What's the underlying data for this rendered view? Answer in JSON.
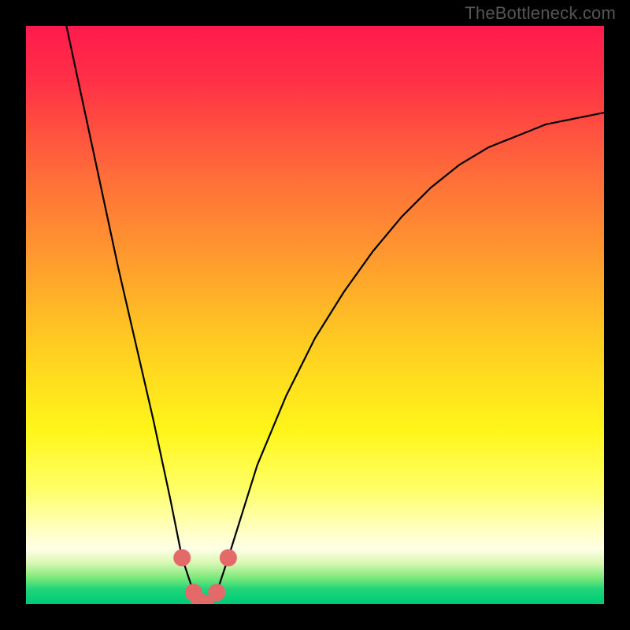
{
  "watermark": "TheBottleneck.com",
  "chart_data": {
    "type": "line",
    "title": "",
    "xlabel": "",
    "ylabel": "",
    "xlim": [
      0,
      100
    ],
    "ylim": [
      0,
      100
    ],
    "grid": false,
    "legend": false,
    "background": {
      "type": "vertical-gradient",
      "stops": [
        {
          "offset": 0.0,
          "color": "#ff1a4d"
        },
        {
          "offset": 0.1,
          "color": "#ff3246"
        },
        {
          "offset": 0.25,
          "color": "#ff6a3a"
        },
        {
          "offset": 0.4,
          "color": "#ff9a2e"
        },
        {
          "offset": 0.55,
          "color": "#ffcc22"
        },
        {
          "offset": 0.7,
          "color": "#fff61a"
        },
        {
          "offset": 0.8,
          "color": "#ffff66"
        },
        {
          "offset": 0.87,
          "color": "#ffffc0"
        },
        {
          "offset": 0.905,
          "color": "#ffffe6"
        },
        {
          "offset": 0.93,
          "color": "#d6f7b0"
        },
        {
          "offset": 0.955,
          "color": "#7ae87a"
        },
        {
          "offset": 0.975,
          "color": "#1fd47a"
        },
        {
          "offset": 1.0,
          "color": "#00c977"
        }
      ]
    },
    "series": [
      {
        "name": "bottleneck-curve",
        "x": [
          7,
          10,
          13,
          16,
          19,
          22,
          25,
          27,
          29,
          31,
          33,
          35,
          40,
          45,
          50,
          55,
          60,
          65,
          70,
          75,
          80,
          85,
          90,
          95,
          100
        ],
        "values": [
          100,
          86,
          72,
          58,
          45,
          32,
          18,
          8,
          2,
          0,
          2,
          8,
          24,
          36,
          46,
          54,
          61,
          67,
          72,
          76,
          79,
          81,
          83,
          84,
          85
        ]
      }
    ],
    "markers": {
      "name": "highlight-markers",
      "x": [
        27,
        29,
        30,
        31,
        33,
        35
      ],
      "y": [
        8,
        2,
        0.5,
        0,
        2,
        8
      ],
      "color": "#e46a6a"
    }
  }
}
